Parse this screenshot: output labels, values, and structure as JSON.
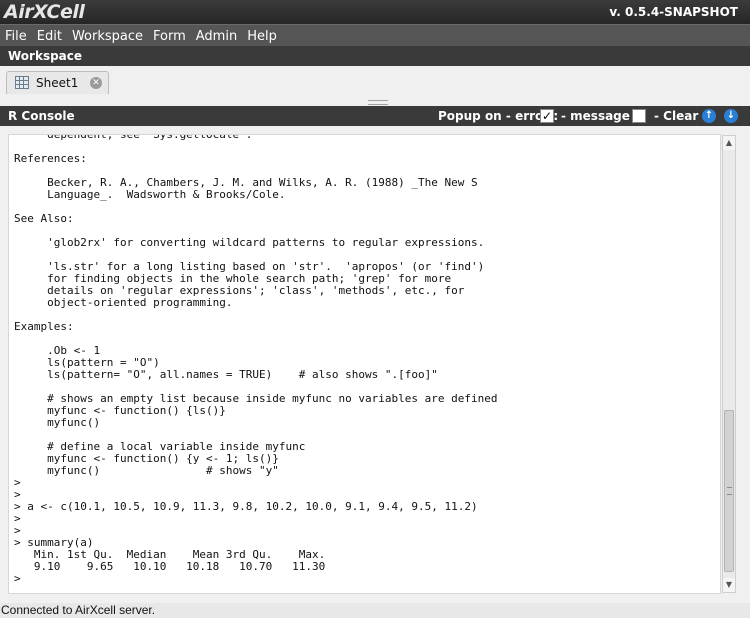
{
  "app": {
    "logo_text": "AirXCell",
    "version": "v. 0.5.4-SNAPSHOT"
  },
  "menu": {
    "items": [
      "File",
      "Edit",
      "Workspace",
      "Form",
      "Admin",
      "Help"
    ]
  },
  "workspace": {
    "title": "Workspace",
    "tabs": [
      {
        "label": "Sheet1",
        "icon": "spreadsheet-icon",
        "close_icon": "close-icon"
      }
    ]
  },
  "console": {
    "title": "R Console",
    "popup_on_error_label": "Popup on - error :",
    "error_checked": true,
    "message_label": "- message :",
    "message_checked": false,
    "clear_label": "-  Clear",
    "scroll_up_icon": "arrow-up-icon",
    "scroll_down_icon": "arrow-down-icon",
    "output_lines": [
      "     dependent, see 'Sys.getlocale'.",
      "",
      "References:",
      "",
      "     Becker, R. A., Chambers, J. M. and Wilks, A. R. (1988) _The New S",
      "     Language_.  Wadsworth & Brooks/Cole.",
      "",
      "See Also:",
      "",
      "     'glob2rx' for converting wildcard patterns to regular expressions.",
      "",
      "     'ls.str' for a long listing based on 'str'.  'apropos' (or 'find')",
      "     for finding objects in the whole search path; 'grep' for more",
      "     details on 'regular expressions'; 'class', 'methods', etc., for",
      "     object-oriented programming.",
      "",
      "Examples:",
      "",
      "     .Ob <- 1",
      "     ls(pattern = \"O\")",
      "     ls(pattern= \"O\", all.names = TRUE)    # also shows \".[foo]\"",
      "",
      "     # shows an empty list because inside myfunc no variables are defined",
      "     myfunc <- function() {ls()}",
      "     myfunc()",
      "",
      "     # define a local variable inside myfunc",
      "     myfunc <- function() {y <- 1; ls()}",
      "     myfunc()                # shows \"y\"",
      ">",
      ">",
      "> a <- c(10.1, 10.5, 10.9, 11.3, 9.8, 10.2, 10.0, 9.1, 9.4, 9.5, 11.2)",
      ">",
      ">",
      "> summary(a)",
      "   Min. 1st Qu.  Median    Mean 3rd Qu.    Max. ",
      "   9.10    9.65   10.10   10.18   10.70   11.30 ",
      ">"
    ]
  },
  "status": {
    "text": "Connected to AirXcell server."
  }
}
